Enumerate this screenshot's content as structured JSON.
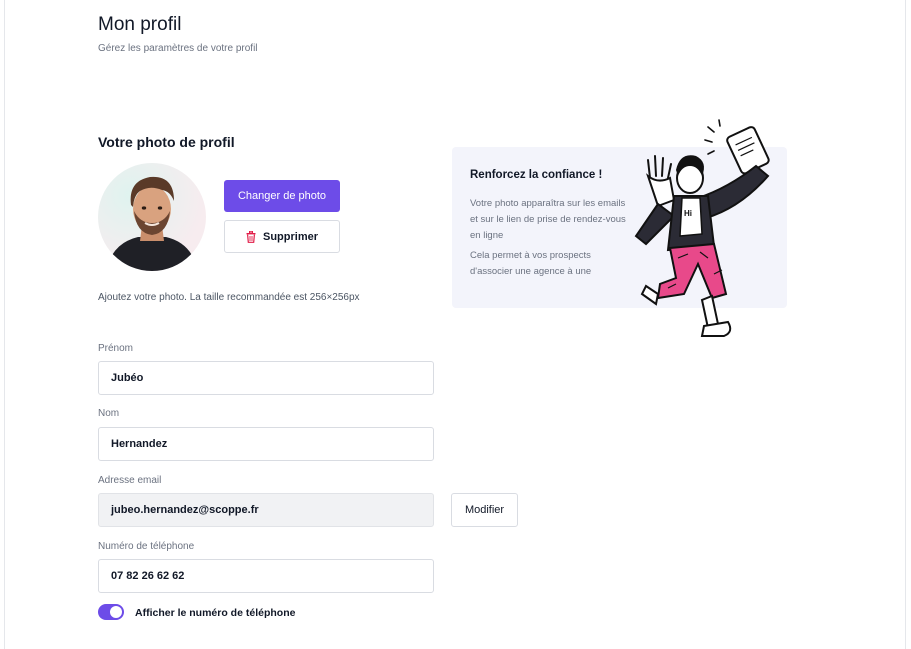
{
  "page": {
    "title": "Mon profil",
    "subtitle": "Gérez les paramètres de votre profil"
  },
  "photo_section": {
    "title": "Votre photo de profil",
    "change_button": "Changer de photo",
    "delete_button": "Supprimer",
    "hint": "Ajoutez votre photo. La taille recommandée est 256×256px"
  },
  "info_card": {
    "title": "Renforcez la confiance !",
    "paragraph1": "Votre photo apparaîtra sur les emails et sur le lien de prise de rendez-vous en ligne",
    "paragraph2": "Cela permet à vos prospects d'associer une agence à une",
    "illustration_text": "Hi"
  },
  "form": {
    "first_name": {
      "label": "Prénom",
      "value": "Jubéo"
    },
    "last_name": {
      "label": "Nom",
      "value": "Hernandez"
    },
    "email": {
      "label": "Adresse email",
      "value": "jubeo.hernandez@scoppe.fr",
      "modify_button": "Modifier"
    },
    "phone": {
      "label": "Numéro de téléphone",
      "value": "07 82 26 62 62"
    },
    "show_phone": {
      "label": "Afficher le numéro de téléphone",
      "checked": true
    }
  },
  "colors": {
    "accent": "#6d4ce8",
    "danger": "#e11d48",
    "card_bg": "#f3f4fb",
    "illustration_pink": "#e8498a"
  },
  "icons": {
    "delete": "trash-icon",
    "toggle": "toggle-switch"
  }
}
